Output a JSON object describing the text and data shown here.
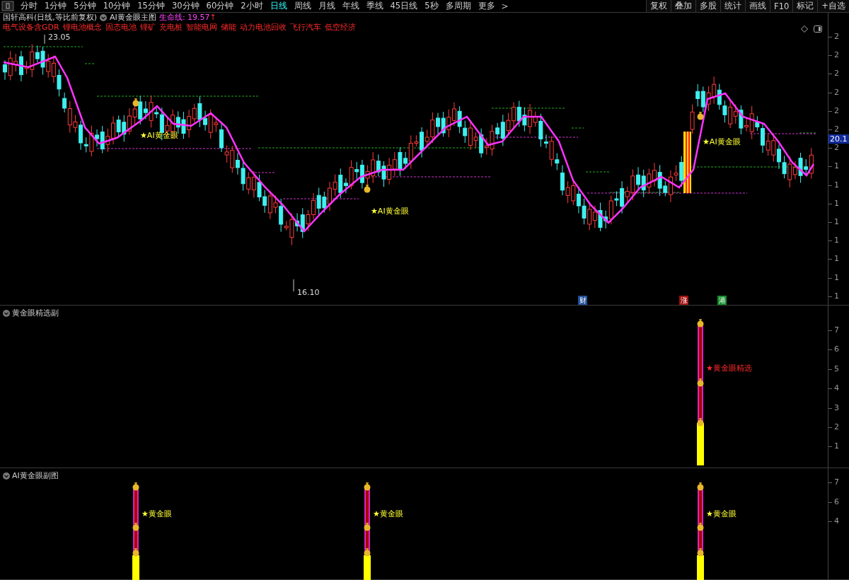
{
  "toolbar": {
    "periods": [
      {
        "label": "分时",
        "selected": false
      },
      {
        "label": "1分钟",
        "selected": false
      },
      {
        "label": "5分钟",
        "selected": false
      },
      {
        "label": "10分钟",
        "selected": false
      },
      {
        "label": "15分钟",
        "selected": false
      },
      {
        "label": "30分钟",
        "selected": false
      },
      {
        "label": "60分钟",
        "selected": false
      },
      {
        "label": "2小时",
        "selected": false
      },
      {
        "label": "日线",
        "selected": true
      },
      {
        "label": "周线",
        "selected": false
      },
      {
        "label": "月线",
        "selected": false
      },
      {
        "label": "年线",
        "selected": false
      },
      {
        "label": "季线",
        "selected": false
      },
      {
        "label": "45日线",
        "selected": false
      },
      {
        "label": "5秒",
        "selected": false
      },
      {
        "label": "多周期",
        "selected": false
      },
      {
        "label": "更多",
        "selected": false
      }
    ],
    "next_arrow": ">",
    "buttons": [
      "复权",
      "叠加",
      "多股",
      "统计",
      "画线",
      "F10",
      "标记",
      "+自选"
    ]
  },
  "chart_header": {
    "stock": "国轩高科(日线,等比前复权)",
    "indicator": "AI黄金眼主图",
    "life_line": "生命线: 19.57",
    "trend_arrow": "↑"
  },
  "concept_tags": [
    "电气设备含GDR",
    "锂电池概念",
    "固态电池",
    "锂矿",
    "充电桩",
    "智能电网",
    "储能",
    "动力电池回收",
    "飞行汽车",
    "低空经济"
  ],
  "main_chart": {
    "high_label": "23.05",
    "low_label": "16.10",
    "signals": [
      "★AI黄金眼",
      "★AI黄金眼",
      "★AI黄金眼"
    ],
    "events": [
      {
        "label": "财",
        "color": "#1f4f9a"
      },
      {
        "label": "涨",
        "color": "#a01010"
      },
      {
        "label": "港",
        "color": "#138a2a"
      }
    ],
    "axis_labels": [
      "2",
      "2",
      "2",
      "2",
      "2",
      "2",
      "2",
      "1",
      "1",
      "1",
      "1",
      "1",
      "1",
      "1",
      "1"
    ],
    "price_tag": "20.1"
  },
  "sub_panels": [
    {
      "title": "黄金眼精选副",
      "signals": [
        "★黄金眼精选"
      ],
      "axis_labels": [
        "7",
        "6",
        "5",
        "4",
        "3",
        "2",
        "1"
      ]
    },
    {
      "title": "AI黄金眼副图",
      "signals": [
        "★黄金眼",
        "★黄金眼",
        "★黄金眼"
      ],
      "axis_labels": [
        "7",
        "6",
        "4"
      ]
    }
  ]
}
